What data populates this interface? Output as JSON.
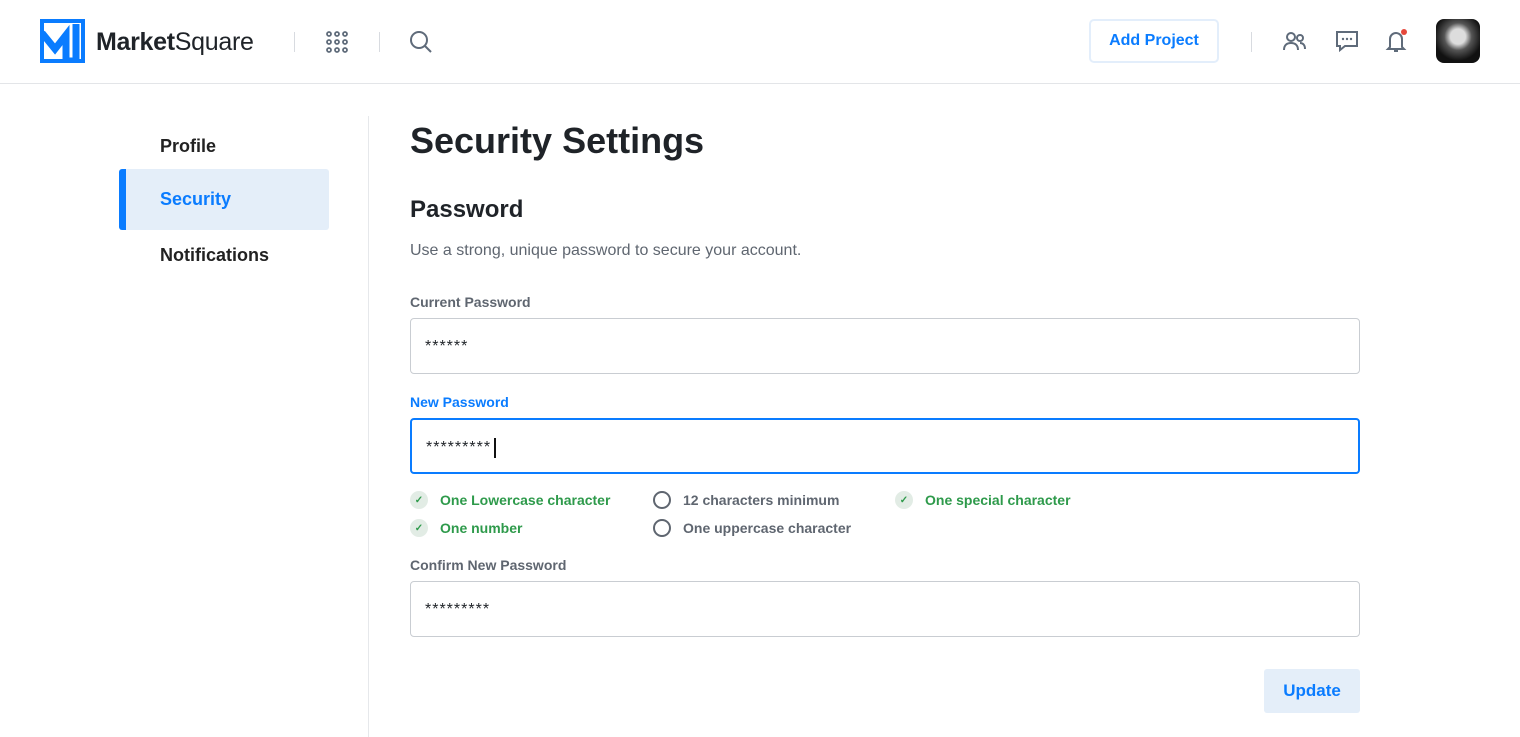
{
  "header": {
    "brand_bold": "Market",
    "brand_light": "Square",
    "add_project": "Add Project",
    "notification_dot_color": "#e5483b",
    "accent": "#0a7cff"
  },
  "sidebar": {
    "items": [
      {
        "label": "Profile"
      },
      {
        "label": "Security",
        "active": true
      },
      {
        "label": "Notifications"
      }
    ]
  },
  "main": {
    "title": "Security Settings",
    "section": "Password",
    "description": "Use a strong, unique password to secure your account.",
    "current_label": "Current Password",
    "current_value": "******",
    "new_label": "New Password",
    "new_value": "*********",
    "rules": [
      {
        "text": "One Lowercase character",
        "met": true
      },
      {
        "text": "12 characters minimum",
        "met": false
      },
      {
        "text": "One special character",
        "met": true
      },
      {
        "text": "One number",
        "met": true
      },
      {
        "text": "One uppercase character",
        "met": false
      }
    ],
    "confirm_label": "Confirm New Password",
    "confirm_value": "*********",
    "update": "Update"
  }
}
